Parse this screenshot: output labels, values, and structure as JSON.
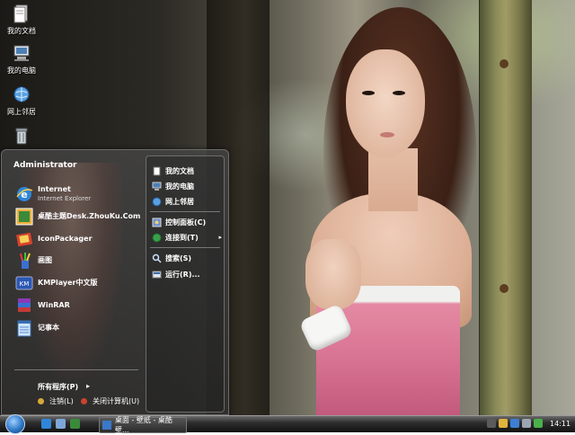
{
  "desktop": {
    "icons": [
      {
        "label": "我的文档",
        "icon": "my-documents-icon"
      },
      {
        "label": "我的电脑",
        "icon": "my-computer-icon"
      },
      {
        "label": "网上邻居",
        "icon": "network-places-icon"
      },
      {
        "label": "",
        "icon": "recycle-bin-icon"
      }
    ]
  },
  "start_menu": {
    "user": "Administrator",
    "programs": [
      {
        "title": "Internet",
        "subtitle": "Internet Explorer",
        "icon": "internet-explorer-icon"
      },
      {
        "title": "桌酷主题Desk.ZhouKu.Com",
        "subtitle": "",
        "icon": "desk-theme-icon"
      },
      {
        "title": "IconPackager",
        "subtitle": "",
        "icon": "iconpackager-icon"
      },
      {
        "title": "画图",
        "subtitle": "",
        "icon": "paint-icon"
      },
      {
        "title": "KMPlayer中文版",
        "subtitle": "",
        "icon": "kmplayer-icon"
      },
      {
        "title": "WinRAR",
        "subtitle": "",
        "icon": "winrar-icon"
      },
      {
        "title": "记事本",
        "subtitle": "",
        "icon": "notepad-icon"
      }
    ],
    "all_programs": "所有程序(P)",
    "logoff": "注销(L)",
    "shutdown": "关闭计算机(U)",
    "right_items": [
      {
        "label": "我的文档",
        "icon": "my-documents-icon"
      },
      {
        "label": "我的电脑",
        "icon": "my-computer-icon"
      },
      {
        "label": "网上邻居",
        "icon": "network-places-icon"
      },
      {
        "label": "控制面板(C)",
        "icon": "control-panel-icon"
      },
      {
        "label": "连接到(T)",
        "icon": "connect-to-icon"
      },
      {
        "label": "搜索(S)",
        "icon": "search-icon"
      },
      {
        "label": "运行(R)...",
        "icon": "run-icon"
      }
    ]
  },
  "taskbar": {
    "task_label": "桌面 - 壁纸 - 桌酷壁...",
    "clock": "14:11"
  }
}
